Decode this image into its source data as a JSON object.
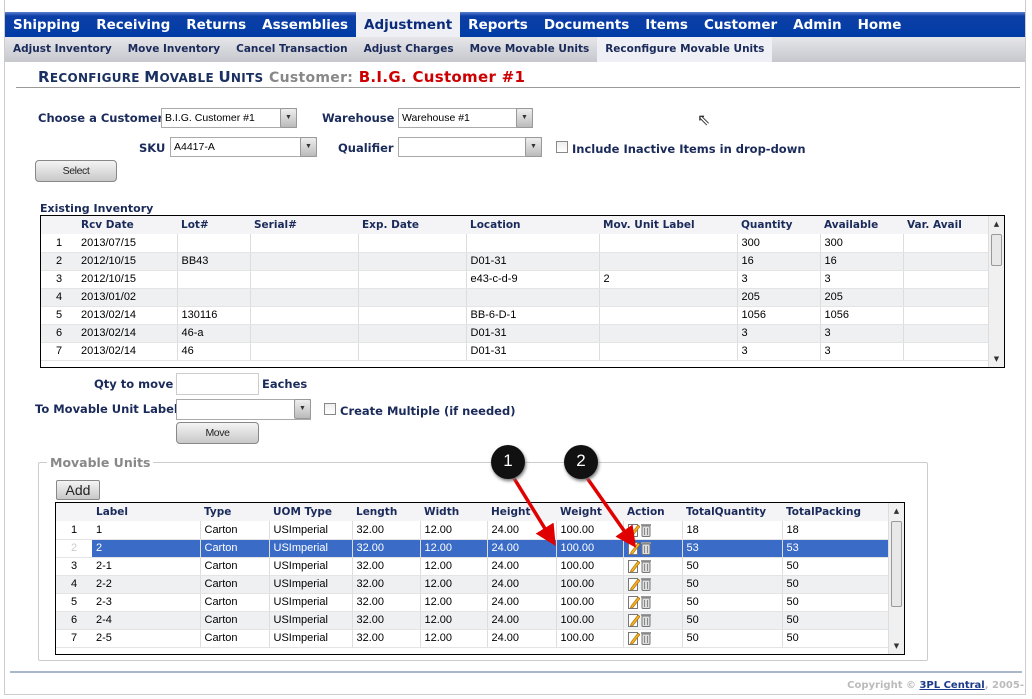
{
  "top_nav": [
    "Shipping",
    "Receiving",
    "Returns",
    "Assemblies",
    "Adjustment",
    "Reports",
    "Documents",
    "Items",
    "Customer",
    "Admin",
    "Home"
  ],
  "top_nav_active": "Adjustment",
  "sub_nav": [
    "Adjust Inventory",
    "Move Inventory",
    "Cancel Transaction",
    "Adjust Charges",
    "Move Movable Units",
    "Reconfigure Movable Units"
  ],
  "sub_nav_active": "Reconfigure Movable Units",
  "page": {
    "title_big1": "R",
    "title_small1": "ECONFIGURE ",
    "title_big2": "M",
    "title_small2": "OVABLE ",
    "title_big3": "U",
    "title_small3": "NITS",
    "customer_label": "Customer:",
    "customer_name": "B.I.G. Customer #1"
  },
  "form": {
    "customer_label": "Choose a Customer",
    "customer_value": "B.I.G. Customer #1",
    "warehouse_label": "Warehouse",
    "warehouse_value": "Warehouse #1",
    "sku_label": "SKU",
    "sku_value": "A4417-A",
    "qualifier_label": "Qualifier",
    "qualifier_value": "",
    "include_inactive_label": "Include Inactive Items in drop-down",
    "select_button": "Select"
  },
  "existing_inventory": {
    "title": "Existing Inventory",
    "columns": [
      "",
      "Rcv Date",
      "Lot#",
      "Serial#",
      "Exp. Date",
      "Location",
      "Mov. Unit Label",
      "Quantity",
      "Available",
      "Var. Avail"
    ],
    "rows": [
      [
        "1",
        "2013/07/15",
        "",
        "",
        "",
        "",
        "",
        "300",
        "300",
        ""
      ],
      [
        "2",
        "2012/10/15",
        "BB43",
        "",
        "",
        "D01-31",
        "",
        "16",
        "16",
        ""
      ],
      [
        "3",
        "2012/10/15",
        "",
        "",
        "",
        "e43-c-d-9",
        "2",
        "3",
        "3",
        ""
      ],
      [
        "4",
        "2013/01/02",
        "",
        "",
        "",
        "",
        "",
        "205",
        "205",
        ""
      ],
      [
        "5",
        "2013/02/14",
        "130116",
        "",
        "",
        "BB-6-D-1",
        "",
        "1056",
        "1056",
        ""
      ],
      [
        "6",
        "2013/02/14",
        "46-a",
        "",
        "",
        "D01-31",
        "",
        "3",
        "3",
        ""
      ],
      [
        "7",
        "2013/02/14",
        "46",
        "",
        "",
        "D01-31",
        "",
        "3",
        "3",
        ""
      ]
    ]
  },
  "move": {
    "qty_label": "Qty to move",
    "qty_value": "",
    "unit_label": "Eaches",
    "to_label": "To Movable Unit Label",
    "to_value": "",
    "create_multiple_label": "Create Multiple (if needed)",
    "move_button": "Move"
  },
  "movable_units": {
    "legend": "Movable Units",
    "add_button": "Add",
    "columns": [
      "",
      "Label",
      "Type",
      "UOM Type",
      "Length",
      "Width",
      "Height",
      "Weight",
      "Action",
      "TotalQuantity",
      "TotalPacking"
    ],
    "selected_row": 2,
    "rows": [
      [
        "1",
        "1",
        "Carton",
        "USImperial",
        "32.00",
        "12.00",
        "24.00",
        "100.00",
        "",
        "18",
        "18"
      ],
      [
        "2",
        "2",
        "Carton",
        "USImperial",
        "32.00",
        "12.00",
        "24.00",
        "100.00",
        "",
        "53",
        "53"
      ],
      [
        "3",
        "2-1",
        "Carton",
        "USImperial",
        "32.00",
        "12.00",
        "24.00",
        "100.00",
        "",
        "50",
        "50"
      ],
      [
        "4",
        "2-2",
        "Carton",
        "USImperial",
        "32.00",
        "12.00",
        "24.00",
        "100.00",
        "",
        "50",
        "50"
      ],
      [
        "5",
        "2-3",
        "Carton",
        "USImperial",
        "32.00",
        "12.00",
        "24.00",
        "100.00",
        "",
        "50",
        "50"
      ],
      [
        "6",
        "2-4",
        "Carton",
        "USImperial",
        "32.00",
        "12.00",
        "24.00",
        "100.00",
        "",
        "50",
        "50"
      ],
      [
        "7",
        "2-5",
        "Carton",
        "USImperial",
        "32.00",
        "12.00",
        "24.00",
        "100.00",
        "",
        "50",
        "50"
      ]
    ]
  },
  "annotations": [
    "1",
    "2"
  ],
  "footer": {
    "copyright": "Copyright ©",
    "link": "3PL Central",
    "year": ", 2005-"
  },
  "colors": {
    "nav": "#003ca6",
    "selected_row": "#3a6bc6",
    "customer_name": "#cc0000",
    "arrow": "#e00000"
  }
}
